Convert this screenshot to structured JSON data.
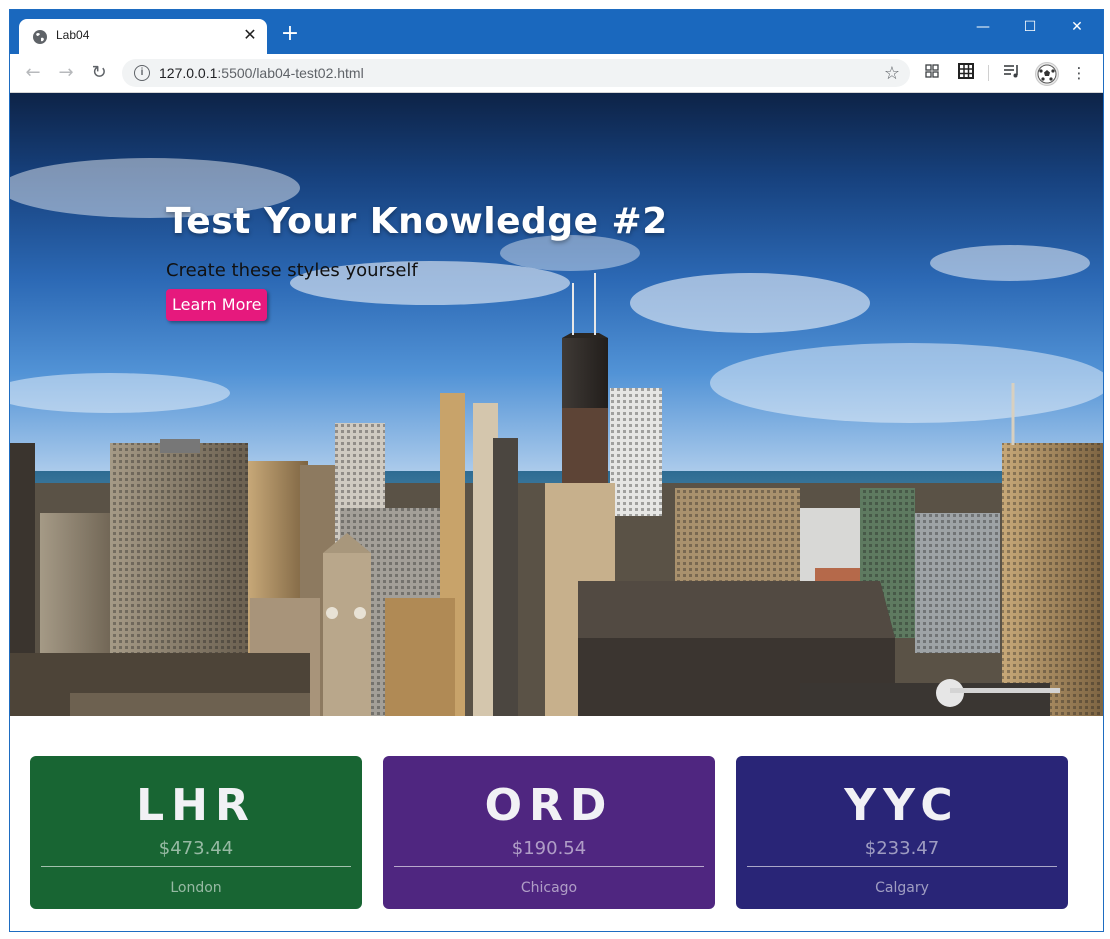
{
  "browser": {
    "tab_title": "Lab04",
    "new_tab_label": "+",
    "close_tab_label": "✕",
    "url_host": "127.0.0.1",
    "url_rest": ":5500/lab04-test02.html",
    "window_controls": {
      "minimize": "—",
      "maximize": "☐",
      "close": "✕"
    }
  },
  "hero": {
    "title": "Test Your Knowledge #2",
    "subtitle": "Create these styles yourself",
    "button_label": "Learn More",
    "button_color": "#e6197d"
  },
  "cards": [
    {
      "code": "LHR",
      "price": "$473.44",
      "city": "London",
      "color": "#186533"
    },
    {
      "code": "ORD",
      "price": "$190.54",
      "city": "Chicago",
      "color": "#4f2680"
    },
    {
      "code": "YYC",
      "price": "$233.47",
      "city": "Calgary",
      "color": "#292577"
    }
  ]
}
